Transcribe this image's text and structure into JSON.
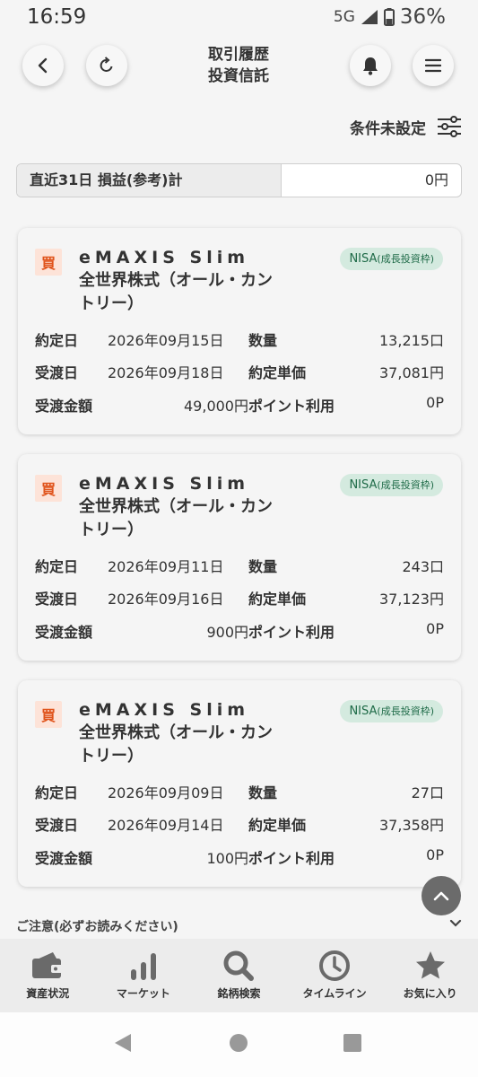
{
  "status": {
    "time": "16:59",
    "network": "5G",
    "battery": "36%"
  },
  "header": {
    "title_line1": "取引履歴",
    "title_line2": "投資信託"
  },
  "filter": {
    "label": "条件未設定"
  },
  "summary": {
    "label": "直近31日 損益(参考)計",
    "value": "0円"
  },
  "labels": {
    "buy": "買",
    "trade_date": "約定日",
    "settle_date": "受渡日",
    "amount": "受渡金額",
    "quantity": "数量",
    "unit_price": "約定単価",
    "points": "ポイント利用",
    "nisa_main": "NISA",
    "nisa_sub": "(成長投資枠)"
  },
  "transactions": [
    {
      "name_line1": "eMAXIS Slim",
      "name_line2": "全世界株式（オール・カン",
      "name_line3": "トリー）",
      "trade_date": "2026年09月15日",
      "settle_date": "2026年09月18日",
      "amount": "49,000円",
      "quantity": "13,215口",
      "unit_price": "37,081円",
      "points": "0P"
    },
    {
      "name_line1": "eMAXIS Slim",
      "name_line2": "全世界株式（オール・カン",
      "name_line3": "トリー）",
      "trade_date": "2026年09月11日",
      "settle_date": "2026年09月16日",
      "amount": "900円",
      "quantity": "243口",
      "unit_price": "37,123円",
      "points": "0P"
    },
    {
      "name_line1": "eMAXIS Slim",
      "name_line2": "全世界株式（オール・カン",
      "name_line3": "トリー）",
      "trade_date": "2026年09月09日",
      "settle_date": "2026年09月14日",
      "amount": "100円",
      "quantity": "27口",
      "unit_price": "37,358円",
      "points": "0P"
    }
  ],
  "caution": "ご注意(必ずお読みください)",
  "tabs": [
    {
      "label": "資産状況",
      "icon": "wallet-icon"
    },
    {
      "label": "マーケット",
      "icon": "bar-chart-icon"
    },
    {
      "label": "銘柄検索",
      "icon": "search-icon"
    },
    {
      "label": "タイムライン",
      "icon": "clock-icon"
    },
    {
      "label": "お気に入り",
      "icon": "star-icon"
    }
  ]
}
